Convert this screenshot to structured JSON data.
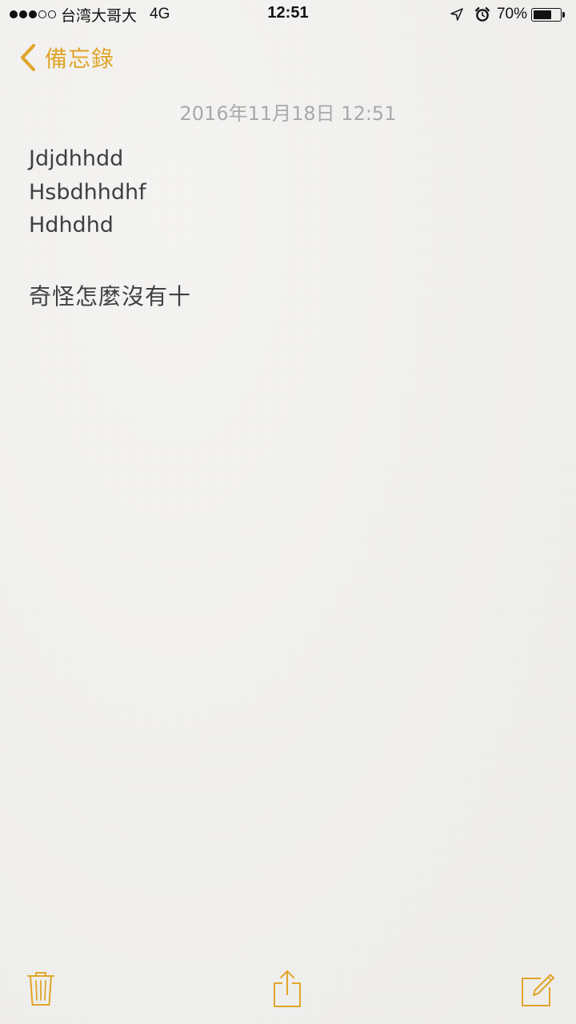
{
  "status_bar": {
    "signal_full": 3,
    "signal_empty": 2,
    "carrier": "台湾大哥大",
    "network": "4G",
    "time": "12:51",
    "battery_percent_label": "70%",
    "battery_level": 0.7
  },
  "nav": {
    "back_label": "備忘錄",
    "accent_color": "#e0a52a"
  },
  "note": {
    "date": "2016年11月18日 12:51",
    "lines": [
      "Jdjdhhdd",
      "Hsbdhhdhf",
      "Hdhdhd",
      "",
      "奇怪怎麼沒有十"
    ]
  },
  "toolbar": {
    "items": [
      "trash-icon",
      "share-icon",
      "compose-icon"
    ]
  }
}
